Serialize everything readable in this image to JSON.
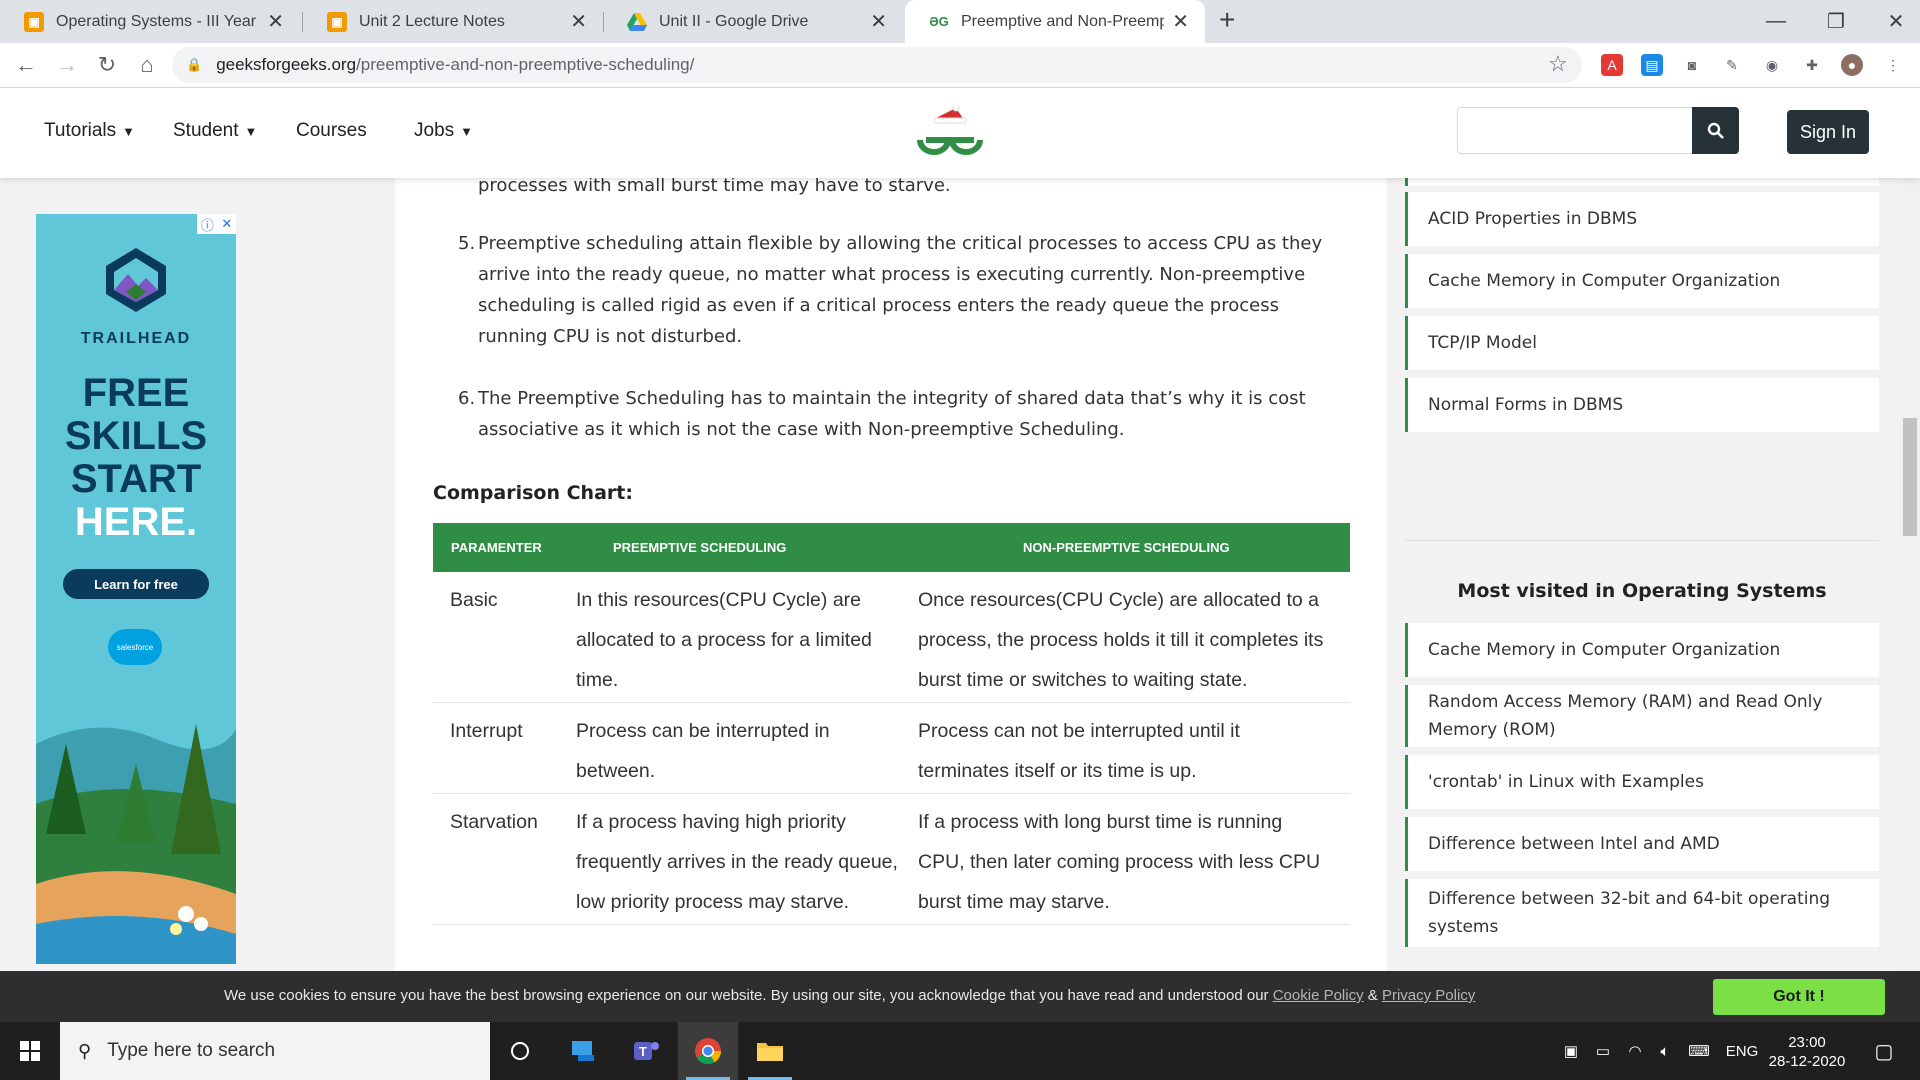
{
  "tabs": [
    {
      "title": "Operating Systems - III Year IT (B",
      "icon": "classroom-icon",
      "color": "#f29900"
    },
    {
      "title": "Unit 2 Lecture Notes",
      "icon": "classroom-icon",
      "color": "#f29900"
    },
    {
      "title": "Unit II - Google Drive",
      "icon": "drive-icon",
      "color": "#1fa463"
    },
    {
      "title": "Preemptive and Non-Preemptive",
      "icon": "gfg-icon",
      "color": "#2f8d46"
    }
  ],
  "address": {
    "domain": "geeksforgeeks.org",
    "path": "/preemptive-and-non-preemptive-scheduling/"
  },
  "nav": {
    "tutorials": "Tutorials",
    "student": "Student",
    "courses": "Courses",
    "jobs": "Jobs",
    "sign_in": "Sign In"
  },
  "ad": {
    "brand": "TRAILHEAD",
    "headline": [
      "FREE",
      "SKILLS",
      "START",
      "HERE."
    ],
    "cta": "Learn for free",
    "sponsor": "salesforce"
  },
  "article": {
    "cut_line": "processes with small burst time may have to starve.",
    "points": [
      {
        "num": "5.",
        "text": "Preemptive scheduling attain flexible by allowing the critical processes to access CPU as they arrive into the ready queue, no matter what process is executing currently. Non-preemptive scheduling is called rigid as even if a critical process enters the ready queue the process running CPU is not disturbed."
      },
      {
        "num": "6.",
        "text": "The Preemptive Scheduling has to maintain the integrity of shared data that’s why it is cost associative as it which is not the case with Non-preemptive Scheduling."
      }
    ],
    "comparison_title": "Comparison Chart:",
    "table": {
      "headers": [
        "PARAMENTER",
        "PREEMPTIVE SCHEDULING",
        "NON-PREEMPTIVE SCHEDULING"
      ],
      "rows": [
        [
          "Basic",
          "In this resources(CPU Cycle) are allocated to a process for a limited time.",
          "Once resources(CPU Cycle) are allocated to a process, the process holds it till it completes its burst time or switches to waiting state."
        ],
        [
          "Interrupt",
          "Process can be interrupted in between.",
          "Process can not be interrupted until it terminates itself or its time is up."
        ],
        [
          "Starvation",
          "If a process having high priority frequently arrives in the ready queue, low priority process may starve.",
          "If a process with long burst time is running CPU, then later coming process with less CPU burst time may starve."
        ]
      ]
    }
  },
  "sidebar": {
    "top_links": [
      "ACID Properties in DBMS",
      "Cache Memory in Computer Organization",
      "TCP/IP Model",
      "Normal Forms in DBMS"
    ],
    "most_visited_title": "Most visited in Operating Systems",
    "most_visited": [
      "Cache Memory in Computer Organization",
      "Random Access Memory (RAM) and Read Only Memory (ROM)",
      "'crontab' in Linux with Examples",
      "Difference between Intel and AMD",
      "Difference between 32-bit and 64-bit operating systems"
    ]
  },
  "cookie": {
    "text": "We use cookies to ensure you have the best browsing experience on our website. By using our site, you acknowledge that you have read and understood our ",
    "cookie_policy": "Cookie Policy",
    "amp": " & ",
    "privacy_policy": "Privacy Policy",
    "button": "Got It !"
  },
  "taskbar": {
    "search_placeholder": "Type here to search",
    "lang": "ENG",
    "time": "23:00",
    "date": "28-12-2020"
  },
  "colors": {
    "gfg_green": "#2f8d46",
    "dark_button": "#263238",
    "cookie_button": "#7ae046"
  }
}
